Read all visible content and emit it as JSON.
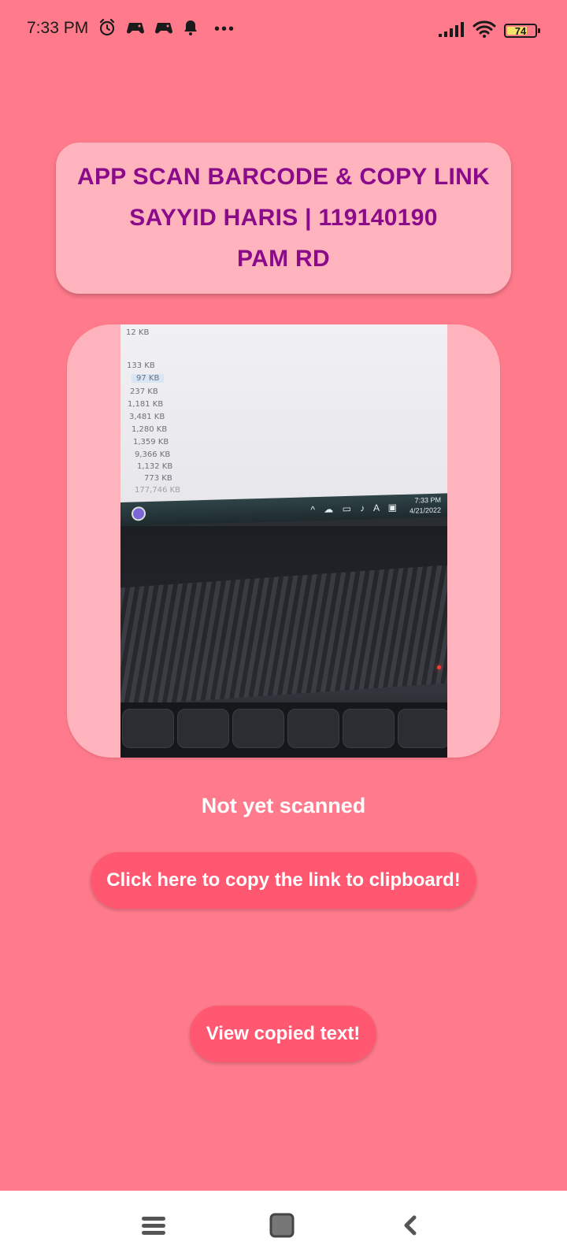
{
  "status_bar": {
    "time": "7:33 PM",
    "left_icons": [
      "alarm-icon",
      "game-controller-icon",
      "game-controller-icon",
      "bell-icon",
      "more-dots-icon"
    ],
    "more_dots": "•••",
    "right_icons": [
      "signal-icon",
      "wifi-icon",
      "battery-icon"
    ],
    "battery_level": "74",
    "battery_fraction": 0.74
  },
  "header": {
    "line1": "APP SCAN BARCODE & COPY LINK",
    "line2": "SAYYID HARIS | 119140190",
    "line3": "PAM RD"
  },
  "camera_preview": {
    "file_sizes": [
      "12 KB",
      "133 KB",
      "97 KB",
      "237 KB",
      "1,181 KB",
      "3,481 KB",
      "1,280 KB",
      "1,359 KB",
      "9,366 KB",
      "1,132 KB",
      "773 KB",
      "177,746 KB"
    ],
    "tray_text": "A",
    "clock_time": "7:33 PM",
    "clock_date": "4/21/2022"
  },
  "scan": {
    "status": "Not yet scanned"
  },
  "buttons": {
    "copy_link": "Click here to copy the link to clipboard!",
    "view_copied": "View copied text!"
  },
  "nav_bar": {
    "icons": [
      "menu-icon",
      "home-square-icon",
      "back-chevron-icon"
    ]
  },
  "colors": {
    "background": "#ff7b8c",
    "card": "#ffb3bd",
    "title_text": "#8a0a8a",
    "button": "#ff5870"
  }
}
